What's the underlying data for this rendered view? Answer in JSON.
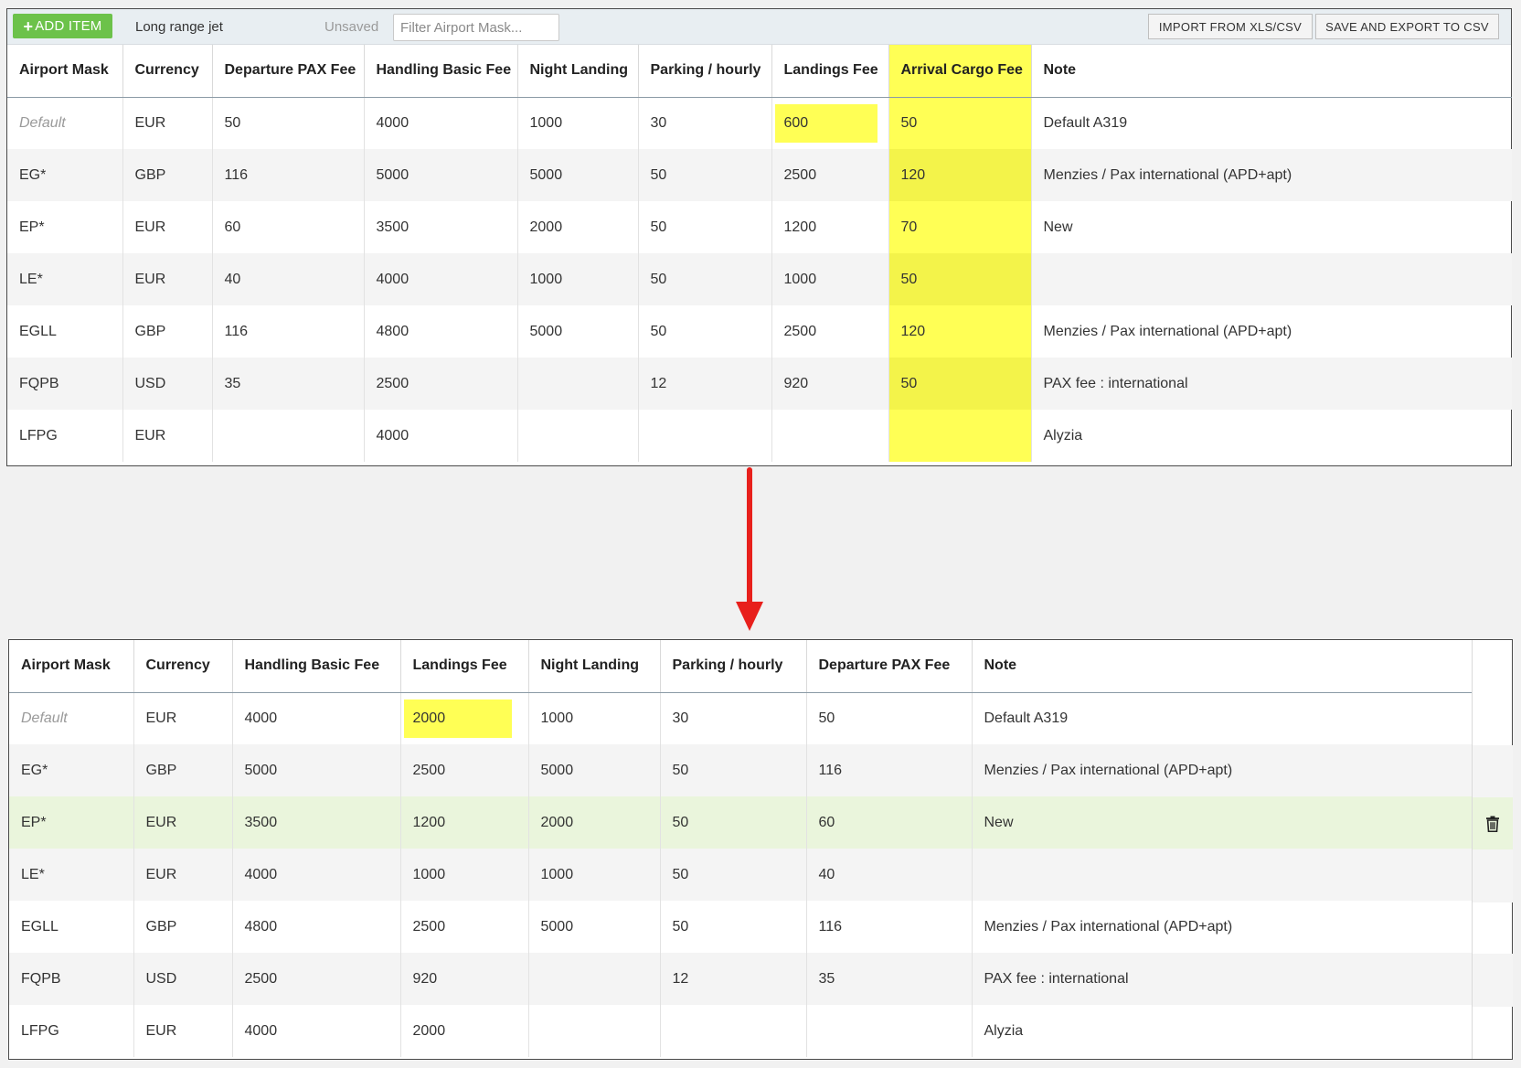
{
  "toolbar": {
    "add_label": "ADD ITEM",
    "name": "Long range jet",
    "status": "Unsaved",
    "filter_placeholder": "Filter Airport Mask...",
    "import_label": "IMPORT FROM XLS/CSV",
    "export_label": "SAVE AND EXPORT TO CSV"
  },
  "top_table": {
    "headers": [
      "Airport Mask",
      "Currency",
      "Departure PAX Fee",
      "Handling Basic Fee",
      "Night Landing",
      "Parking / hourly",
      "Landings Fee",
      "Arrival Cargo Fee",
      "Note"
    ],
    "rows": [
      [
        "Default",
        "EUR",
        "50",
        "4000",
        "1000",
        "30",
        "600",
        "50",
        "Default A319"
      ],
      [
        "EG*",
        "GBP",
        "116",
        "5000",
        "5000",
        "50",
        "2500",
        "120",
        "Menzies / Pax international (APD+apt)"
      ],
      [
        "EP*",
        "EUR",
        "60",
        "3500",
        "2000",
        "50",
        "1200",
        "70",
        "New"
      ],
      [
        "LE*",
        "EUR",
        "40",
        "4000",
        "1000",
        "50",
        "1000",
        "50",
        ""
      ],
      [
        "EGLL",
        "GBP",
        "116",
        "4800",
        "5000",
        "50",
        "2500",
        "120",
        "Menzies / Pax international (APD+apt)"
      ],
      [
        "FQPB",
        "USD",
        "35",
        "2500",
        "",
        "12",
        "920",
        "50",
        "PAX fee : international"
      ],
      [
        "LFPG",
        "EUR",
        "",
        "4000",
        "",
        "",
        "",
        "",
        "Alyzia"
      ]
    ]
  },
  "bottom_table": {
    "headers": [
      "Airport Mask",
      "Currency",
      "Handling Basic Fee",
      "Landings Fee",
      "Night Landing",
      "Parking / hourly",
      "Departure PAX Fee",
      "Note"
    ],
    "rows": [
      [
        "Default",
        "EUR",
        "4000",
        "2000",
        "1000",
        "30",
        "50",
        "Default A319"
      ],
      [
        "EG*",
        "GBP",
        "5000",
        "2500",
        "5000",
        "50",
        "116",
        "Menzies / Pax international (APD+apt)"
      ],
      [
        "EP*",
        "EUR",
        "3500",
        "1200",
        "2000",
        "50",
        "60",
        "New"
      ],
      [
        "LE*",
        "EUR",
        "4000",
        "1000",
        "1000",
        "50",
        "40",
        ""
      ],
      [
        "EGLL",
        "GBP",
        "4800",
        "2500",
        "5000",
        "50",
        "116",
        "Menzies / Pax international (APD+apt)"
      ],
      [
        "FQPB",
        "USD",
        "2500",
        "920",
        "",
        "12",
        "35",
        "PAX fee : international"
      ],
      [
        "LFPG",
        "EUR",
        "4000",
        "2000",
        "",
        "",
        "",
        "Alyzia"
      ]
    ],
    "selected_row": 2
  },
  "colors": {
    "highlight": "#ffff55",
    "add_button": "#6cc24a",
    "arrow": "#e8201c",
    "selected_row": "#eaf5dc"
  },
  "icons": [
    "plus-icon",
    "trash-icon",
    "down-arrow"
  ]
}
